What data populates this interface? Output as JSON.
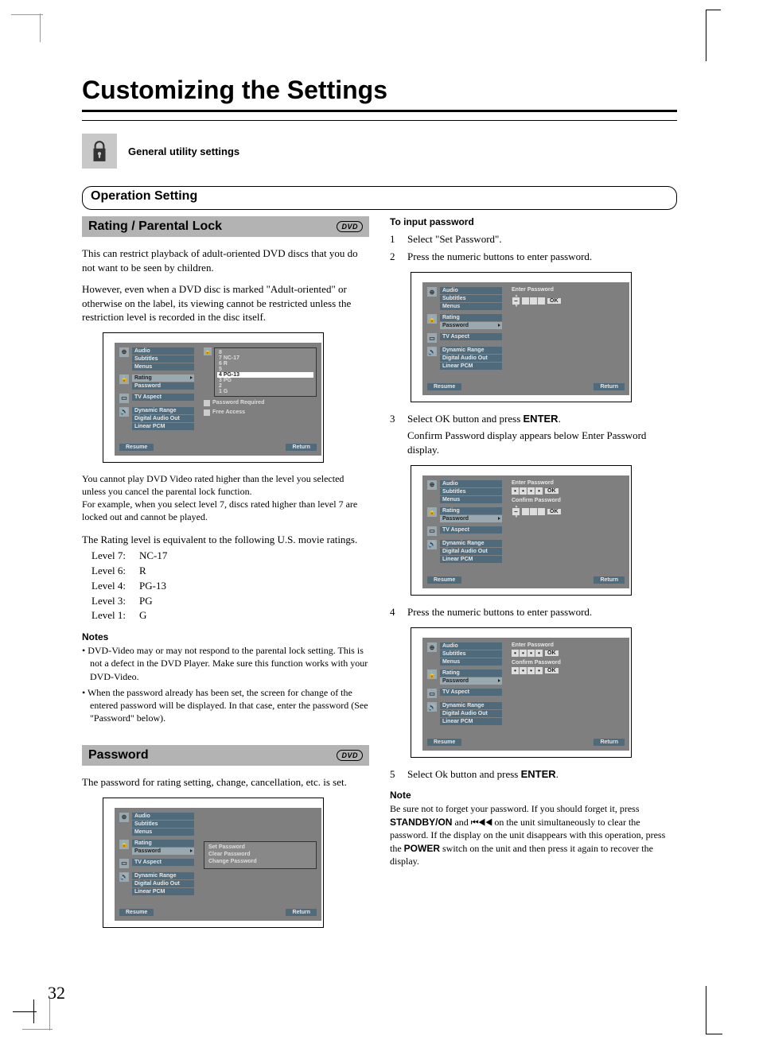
{
  "page_number": "32",
  "title": "Customizing the Settings",
  "utility_label": "General utility settings",
  "section_title": "Operation Setting",
  "dvd_badge": "DVD",
  "rating": {
    "heading": "Rating / Parental Lock",
    "p1": "This can restrict playback of adult-oriented DVD discs that you do not want to be seen by children.",
    "p2": "However, even when a DVD disc is marked \"Adult-oriented\" or otherwise on the label, its viewing cannot be restricted unless the restriction level is recorded in the disc itself.",
    "p3": "You cannot play DVD Video rated higher than the level you selected unless you cancel the parental lock function.",
    "p4": "For example, when you select level 7, discs rated higher than level 7 are locked out and cannot be played.",
    "p5": "The Rating level is equivalent to the following U.S. movie ratings.",
    "levels": [
      {
        "lv": "Level 7:",
        "rt": "NC-17"
      },
      {
        "lv": "Level 6:",
        "rt": "R"
      },
      {
        "lv": "Level 4:",
        "rt": "PG-13"
      },
      {
        "lv": "Level 3:",
        "rt": "PG"
      },
      {
        "lv": "Level 1:",
        "rt": "G"
      }
    ],
    "notes_hd": "Notes",
    "note1": "• DVD-Video may or may not respond to the parental lock setting. This is not a defect in the DVD Player. Make sure this function works with your DVD-Video.",
    "note2": "• When the password already has been set, the screen for change of the entered password will be displayed. In that case, enter the password (See \"Password\" below).",
    "osd": {
      "menu_lang": [
        "Audio",
        "Subtitles",
        "Menus"
      ],
      "lock": [
        "Rating",
        "Password"
      ],
      "tv": [
        "TV Aspect"
      ],
      "audio": [
        "Dynamic Range",
        "Digital Audio Out",
        "Linear PCM"
      ],
      "levels": [
        "8",
        "7 NC-17",
        "6 R",
        "5",
        "4 PG-13",
        "3 PG",
        "2",
        "1 G"
      ],
      "pwreq": "Password Required",
      "free": "Free Access",
      "resume": "Resume",
      "return": "Return"
    }
  },
  "password": {
    "heading": "Password",
    "p1": "The password for rating setting, change, cancellation, etc. is set.",
    "osd_options": [
      "Set Password",
      "Clear Password",
      "Change Password"
    ]
  },
  "right": {
    "hd": "To input password",
    "s1_n": "1",
    "s1_t": "Select \"Set Password\".",
    "s2_n": "2",
    "s2_t": "Press the numeric buttons to enter password.",
    "s3_n": "3",
    "s3_t_a": "Select OK button and press ",
    "s3_t_b": "ENTER",
    "s3_t_c": ".",
    "s3_cont": "Confirm Password display appears below Enter Password display.",
    "s4_n": "4",
    "s4_t": "Press the numeric buttons to enter password.",
    "s5_n": "5",
    "s5_t_a": "Select Ok button and press ",
    "s5_t_b": "ENTER",
    "s5_t_c": ".",
    "note_hd": "Note",
    "note_body_a": "Be sure not to forget your password. If you should forget it, press ",
    "note_body_b": "STANDBY/ON",
    "note_body_c": " and ",
    "note_body_rew": "⏮◀◀",
    "note_body_d": " on the unit simultaneously to clear the password. If the display on the unit disappears with this operation, press the ",
    "note_body_e": "POWER",
    "note_body_f": " switch on the unit and then press it again to recover the display.",
    "osd1": {
      "enter": "Enter Password",
      "ok": "OK"
    },
    "osd2": {
      "enter": "Enter Password",
      "confirm": "Confirm Password",
      "ok": "OK"
    },
    "osd3": {
      "enter": "Enter Password",
      "confirm": "Confirm Password",
      "ok": "OK"
    }
  }
}
